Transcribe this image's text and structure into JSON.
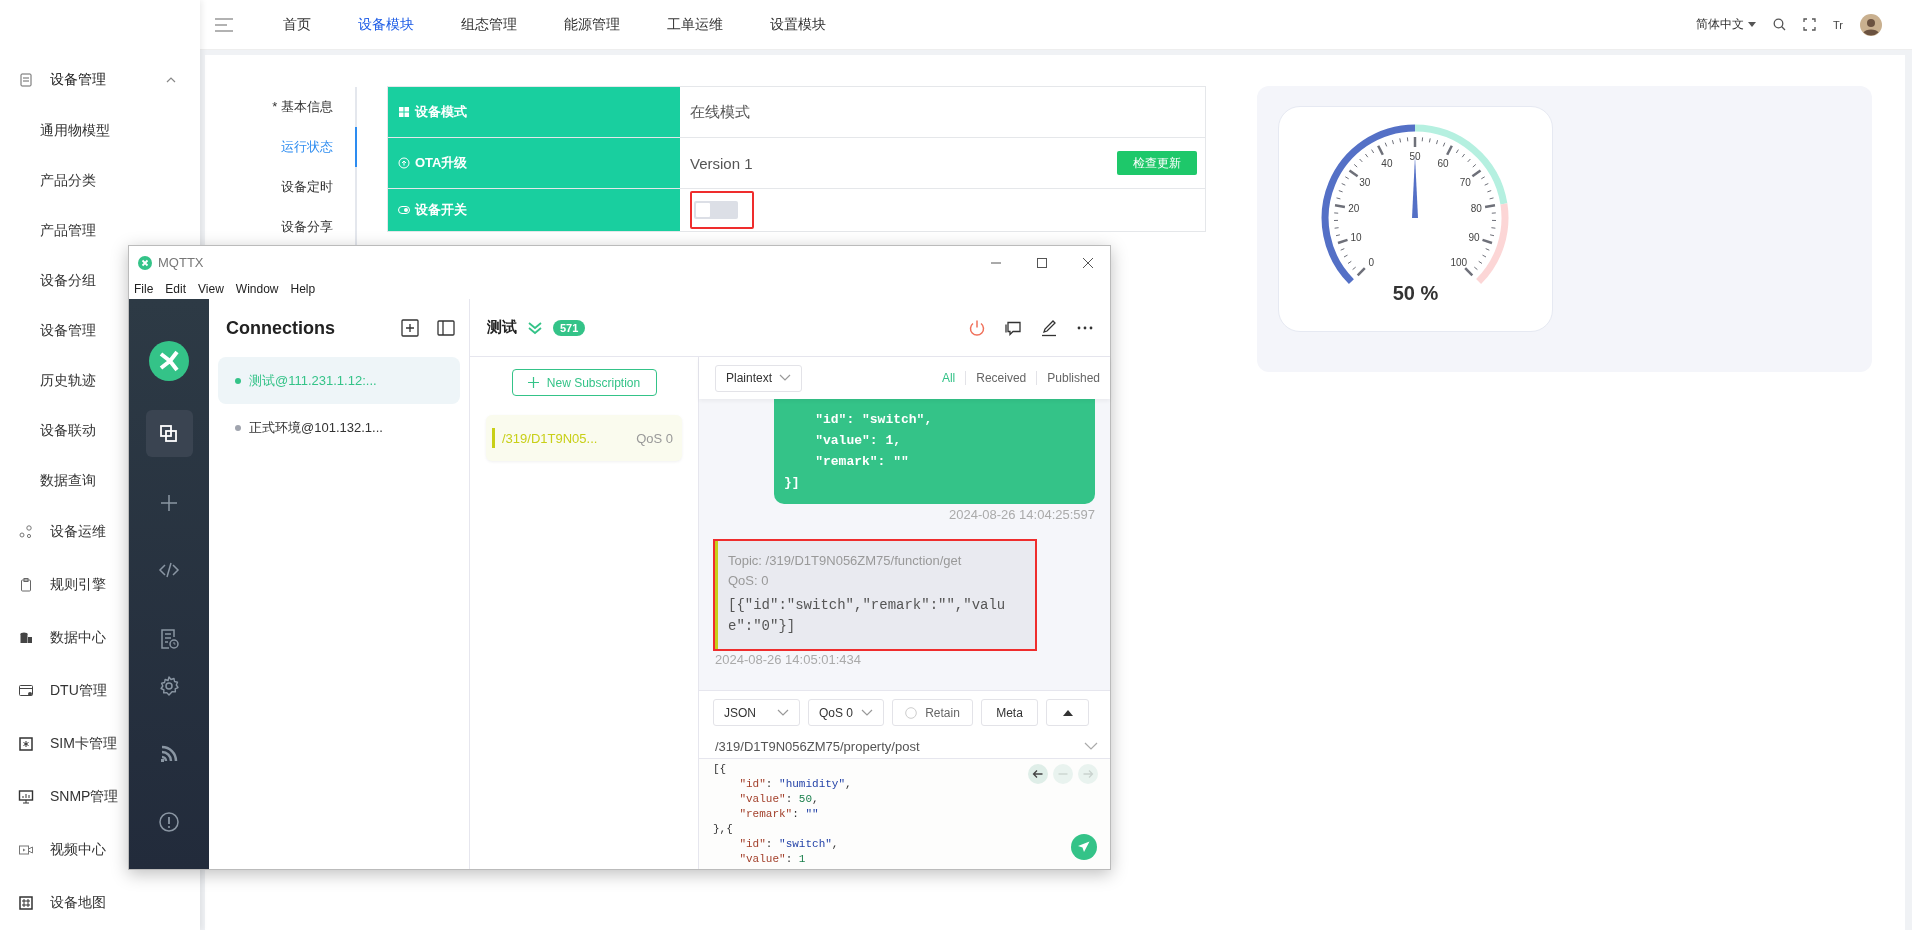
{
  "sidebar": {
    "items": [
      {
        "label": "设备管理",
        "expanded": true,
        "children": [
          {
            "label": "通用物模型"
          },
          {
            "label": "产品分类"
          },
          {
            "label": "产品管理"
          },
          {
            "label": "设备分组"
          },
          {
            "label": "设备管理"
          },
          {
            "label": "历史轨迹"
          },
          {
            "label": "设备联动"
          },
          {
            "label": "数据查询"
          }
        ]
      },
      {
        "label": "设备运维"
      },
      {
        "label": "规则引擎"
      },
      {
        "label": "数据中心"
      },
      {
        "label": "DTU管理"
      },
      {
        "label": "SIM卡管理"
      },
      {
        "label": "SNMP管理"
      },
      {
        "label": "视频中心"
      },
      {
        "label": "设备地图"
      }
    ]
  },
  "top_nav": {
    "tabs": [
      {
        "label": "首页",
        "selected": false
      },
      {
        "label": "设备模块",
        "selected": true
      },
      {
        "label": "组态管理",
        "selected": false
      },
      {
        "label": "能源管理",
        "selected": false
      },
      {
        "label": "工单运维",
        "selected": false
      },
      {
        "label": "设置模块",
        "selected": false
      }
    ],
    "language": "简体中文",
    "font_button": "Tr"
  },
  "detail_tabs": [
    {
      "label": "* 基本信息",
      "selected": false
    },
    {
      "label": "运行状态",
      "selected": true
    },
    {
      "label": "设备定时",
      "selected": false
    },
    {
      "label": "设备分享",
      "selected": false
    }
  ],
  "properties": [
    {
      "kind": "mode",
      "label": "设备模式",
      "value": "在线模式"
    },
    {
      "kind": "ota",
      "label": "OTA升级",
      "value": "Version 1",
      "button": "检查更新"
    },
    {
      "kind": "switch",
      "label": "设备开关",
      "on": false,
      "highlighted": true
    }
  ],
  "gauge": {
    "level": 0.5,
    "reading": "50 %",
    "scale_labels": [
      "0",
      "10",
      "20",
      "30",
      "40",
      "50",
      "60",
      "70",
      "80",
      "90",
      "100"
    ]
  },
  "mqttx": {
    "title": "MQTTX",
    "menu": [
      "File",
      "Edit",
      "View",
      "Window",
      "Help"
    ],
    "nav_rail": [
      {
        "selected": true
      },
      {
        "selected": false
      },
      {
        "selected": false
      },
      {
        "selected": false
      },
      {
        "selected": false
      },
      {
        "selected": false
      },
      {
        "selected": false
      }
    ],
    "connections_title": "Connections",
    "connections": [
      {
        "name": "测试@111.231.1.12:...",
        "selected": true,
        "connected": true
      },
      {
        "name": "正式环境@101.132.1...",
        "selected": false,
        "connected": false
      }
    ],
    "connection_name": "测试",
    "message_count": "571",
    "new_subscription": "New Subscription",
    "subscriptions": [
      {
        "topic": "/319/D1T9N05...",
        "qos": "QoS 0",
        "color": "#c8cf17"
      }
    ],
    "format": "Plaintext",
    "filters": [
      {
        "label": "All",
        "selected": true
      },
      {
        "label": "Received",
        "selected": false
      },
      {
        "label": "Published",
        "selected": false
      }
    ],
    "messages": [
      {
        "kind": "sent",
        "lines": [
          "    \"id\": \"switch\",",
          "    \"value\": 1,",
          "    \"remark\": \"\"",
          "}]"
        ],
        "time": "2024-08-26 14:04:25:597"
      },
      {
        "kind": "received",
        "topic": "Topic: /319/D1T9N056ZM75/function/get",
        "qos": "QoS: 0",
        "payload": "[{\"id\":\"switch\",\"remark\":\"\",\"value\":\"0\"}]",
        "time": "2024-08-26 14:05:01:434",
        "highlighted": true
      }
    ],
    "publish": {
      "format": "JSON",
      "qos": "QoS 0",
      "retain": {
        "label": "Retain",
        "checked": false
      },
      "meta": "Meta",
      "topic": "/319/D1T9N056ZM75/property/post",
      "editor_lines": [
        "[{",
        "    \"id\": \"humidity\",",
        "    \"value\": 50,",
        "    \"remark\": \"\"",
        "},{",
        "    \"id\": \"switch\",",
        "    \"value\": 1"
      ]
    }
  }
}
